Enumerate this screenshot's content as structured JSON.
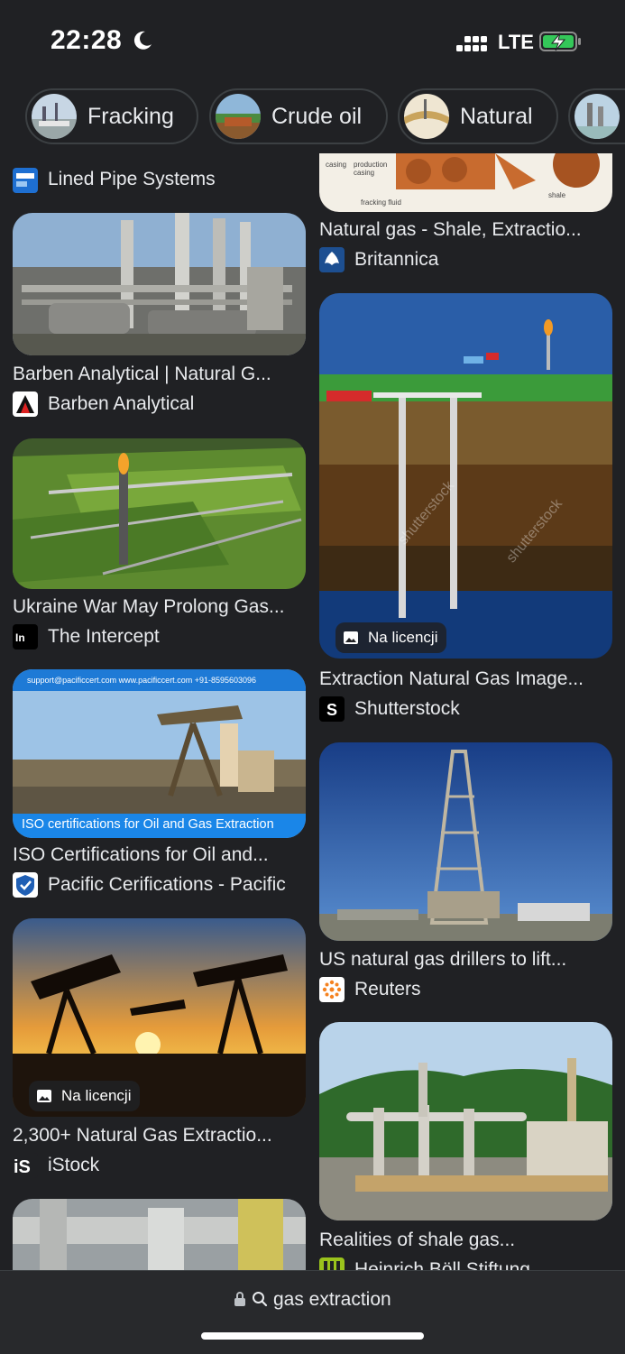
{
  "status": {
    "time": "22:28",
    "network": "LTE"
  },
  "chips": [
    {
      "label": "Fracking"
    },
    {
      "label": "Crude oil"
    },
    {
      "label": "Natural"
    }
  ],
  "left_column": [
    {
      "source": "Lined Pipe Systems"
    },
    {
      "title": "Barben Analytical | Natural G...",
      "source": "Barben Analytical"
    },
    {
      "title": "Ukraine War May Prolong Gas...",
      "source": "The Intercept"
    },
    {
      "title": "ISO Certifications for Oil and...",
      "source": "Pacific Cerifications - Pacific",
      "image_banner": "ISO certifications for Oil and Gas Extraction",
      "image_header": "support@pacificcert.com  www.pacificcert.com  +91-8595603096"
    },
    {
      "title": "2,300+ Natural Gas Extractio...",
      "source": "iStock",
      "badge": "Na licencji"
    }
  ],
  "right_column": [
    {
      "title": "Natural gas - Shale, Extractio...",
      "source": "Britannica",
      "diagram_labels": [
        "casing",
        "production casing",
        "fracking fluid",
        "shale"
      ]
    },
    {
      "title": "Extraction Natural Gas Image...",
      "source": "Shutterstock",
      "badge": "Na licencji",
      "watermark": "shutterstock"
    },
    {
      "title": "US natural gas drillers to lift...",
      "source": "Reuters"
    },
    {
      "title": "Realities of shale gas...",
      "source": "Heinrich Böll Stiftung"
    }
  ],
  "address_bar": {
    "query": "gas extraction"
  },
  "colors": {
    "background": "#202124",
    "text": "#e8eaed",
    "chip_border": "#3c4043",
    "bottom_bar": "#28292c"
  }
}
